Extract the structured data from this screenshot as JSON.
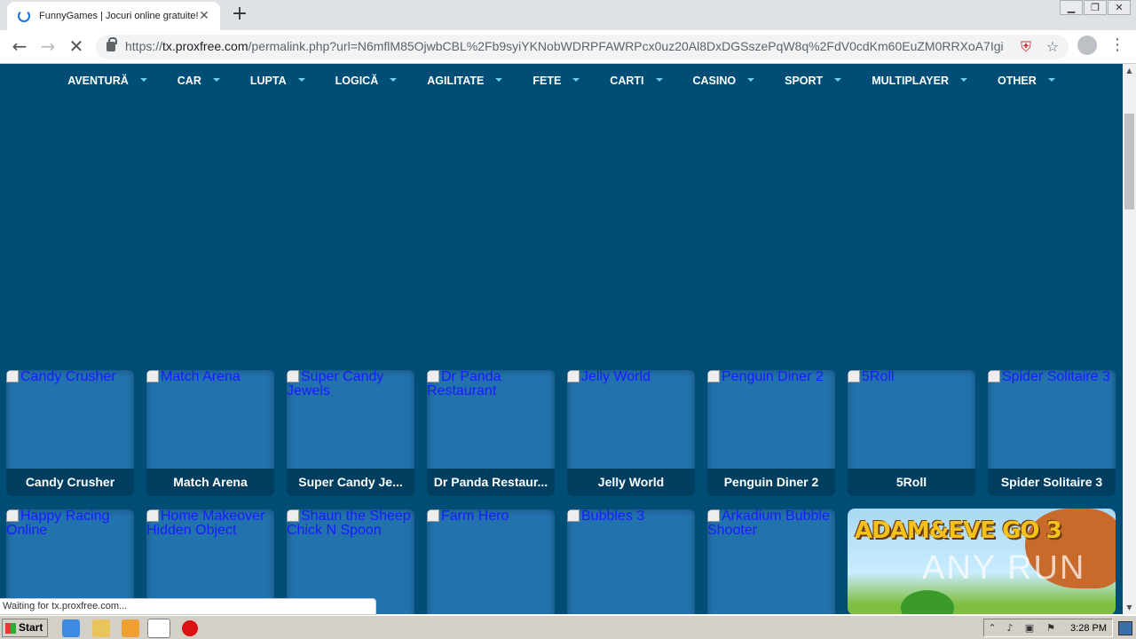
{
  "browser": {
    "tab_title": "FunnyGames | Jocuri online gratuite!",
    "url_scheme": "https://",
    "url_host": "tx.proxfree.com",
    "url_rest": "/permalink.php?url=N6mflM85OjwbCBL%2Fb9syiYKNobWDRPFAWRPcx0uz20Al8DxDGSszePqW8q%2FdV0cdKm60EuZM0RRXoA7Igiu..."
  },
  "nav": {
    "items": [
      "AVENTURĂ",
      "CAR",
      "LUPTA",
      "LOGICĂ",
      "AGILITATE",
      "FETE",
      "CARTI",
      "CASINO",
      "SPORT",
      "MULTIPLAYER",
      "OTHER"
    ]
  },
  "games_row1": [
    {
      "alt": "Candy Crusher",
      "label": "Candy Crusher"
    },
    {
      "alt": "Match Arena",
      "label": "Match Arena"
    },
    {
      "alt": "Super Candy Jewels",
      "label": "Super Candy Je..."
    },
    {
      "alt": "Dr Panda Restaurant",
      "label": "Dr Panda Restaur..."
    },
    {
      "alt": "Jelly World",
      "label": "Jelly World"
    },
    {
      "alt": "Penguin Diner 2",
      "label": "Penguin Diner 2"
    },
    {
      "alt": "5Roll",
      "label": "5Roll"
    },
    {
      "alt": "Spider Solitaire 3",
      "label": "Spider Solitaire 3"
    }
  ],
  "games_row2": [
    {
      "alt": "Happy Racing Online"
    },
    {
      "alt": "Home Makeover Hidden Object"
    },
    {
      "alt": "Shaun the Sheep Chick N Spoon"
    },
    {
      "alt": "Farm Hero"
    },
    {
      "alt": "Bubbles 3"
    },
    {
      "alt": "Arkadium Bubble Shooter"
    }
  ],
  "featured": {
    "logo_text": "ADAM&EVE GO 3",
    "watermark": "ANY RUN"
  },
  "status_text": "Waiting for tx.proxfree.com...",
  "taskbar": {
    "start_label": "Start",
    "clock": "3:28 PM"
  }
}
